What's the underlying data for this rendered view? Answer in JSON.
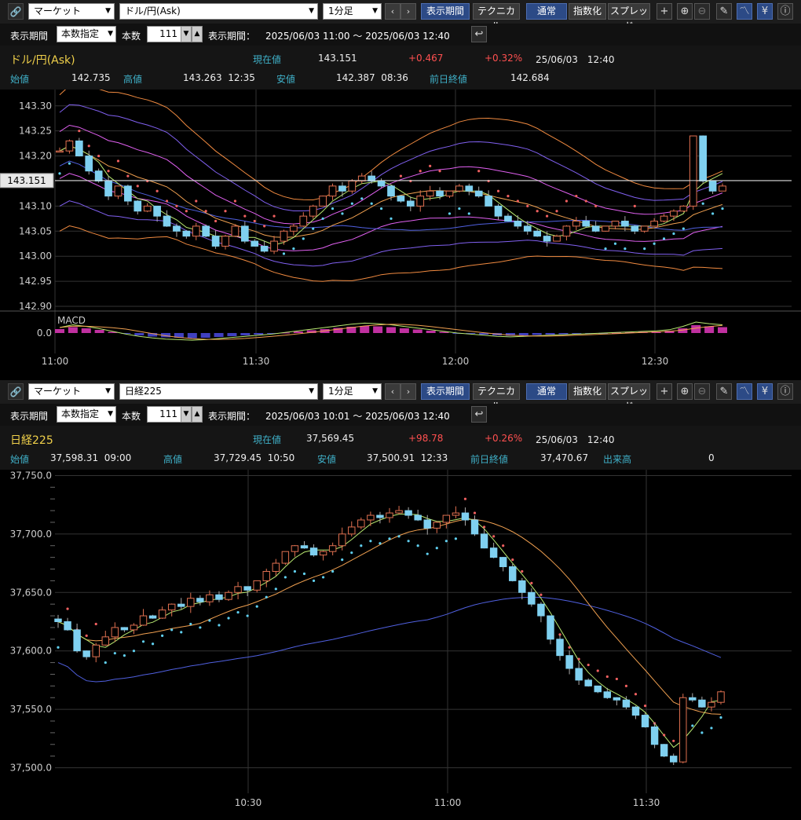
{
  "top": {
    "market_select": "マーケット",
    "symbol_select": "ドル/円(Ask)",
    "interval_select": "1分足",
    "display_period_btn": "表示期間",
    "technical_btn": "テクニカル",
    "normal_btn": "通常",
    "index_btn": "指数化",
    "spread_btn": "スプレッド",
    "period_label": "表示期間",
    "period_mode": "本数指定",
    "count_label": "本数",
    "count_value": "111",
    "range_label": "表示期間：",
    "range_value": "2025/06/03 11:00 〜 2025/06/03 12:40",
    "symbol_name": "ドル/円(Ask)",
    "current_label": "現在値",
    "current_value": "143.151",
    "change": "+0.467",
    "change_pct": "+0.32%",
    "datetime": "25/06/03　12:40",
    "open_label": "始値",
    "open_value": "142.735",
    "high_label": "高値",
    "high_value": "143.263  12:35",
    "low_label": "安値",
    "low_value": "142.387  08:36",
    "prev_label": "前日終値",
    "prev_value": "142.684",
    "price_tag": "143.151",
    "macd_label": "MACD"
  },
  "bottom": {
    "market_select": "マーケット",
    "symbol_select": "日経225",
    "interval_select": "1分足",
    "display_period_btn": "表示期間",
    "technical_btn": "テクニカル",
    "normal_btn": "通常",
    "index_btn": "指数化",
    "spread_btn": "スプレッド",
    "period_label": "表示期間",
    "period_mode": "本数指定",
    "count_label": "本数",
    "count_value": "111",
    "range_label": "表示期間：",
    "range_value": "2025/06/03 10:01 〜 2025/06/03 12:40",
    "symbol_name": "日経225",
    "current_label": "現在値",
    "current_value": "37,569.45",
    "change": "+98.78",
    "change_pct": "+0.26%",
    "datetime": "25/06/03　12:40",
    "open_label": "始値",
    "open_value": "37,598.31  09:00",
    "high_label": "高値",
    "high_value": "37,729.45  10:50",
    "low_label": "安値",
    "low_value": "37,500.91  12:33",
    "prev_label": "前日終値",
    "prev_value": "37,470.67",
    "volume_label": "出来高",
    "volume_value": "0"
  },
  "colors": {
    "accent_blue": "#2c4a86",
    "up_candle": "#e07050",
    "down_candle": "#7fd0f0",
    "bb_outer": "#f08a40",
    "bb_mid": "#8060f0",
    "bb_inner": "#e060f0",
    "ma_short": "#b8e870",
    "ma_mid": "#f0a050",
    "ma_long": "#5060e0",
    "sar_up": "#60d0f0",
    "sar_down": "#f06060",
    "price_line": "#ddd",
    "macd_hist": "#c030a0",
    "text_symbol": "#f0d04a",
    "text_label": "#3fb0c8",
    "text_up": "#ff5050"
  },
  "chart_data": [
    {
      "type": "candlestick",
      "title": "ドル/円(Ask)",
      "x_ticks": [
        "11:00",
        "11:30",
        "12:00",
        "12:30"
      ],
      "y_ticks": [
        "143.30",
        "143.25",
        "143.20",
        "143.15",
        "143.10",
        "143.05",
        "143.00",
        "142.95",
        "142.90"
      ],
      "ylim": [
        142.9,
        143.32
      ],
      "grid": true,
      "close": [
        143.21,
        143.23,
        143.2,
        143.17,
        143.15,
        143.12,
        143.14,
        143.11,
        143.09,
        143.1,
        143.08,
        143.06,
        143.05,
        143.04,
        143.06,
        143.04,
        143.02,
        143.04,
        143.06,
        143.03,
        143.02,
        143.01,
        143.03,
        143.05,
        143.06,
        143.08,
        143.1,
        143.12,
        143.14,
        143.13,
        143.15,
        143.16,
        143.15,
        143.14,
        143.12,
        143.11,
        143.1,
        143.12,
        143.13,
        143.12,
        143.13,
        143.14,
        143.13,
        143.12,
        143.1,
        143.08,
        143.07,
        143.06,
        143.05,
        143.04,
        143.03,
        143.04,
        143.06,
        143.07,
        143.06,
        143.05,
        143.06,
        143.07,
        143.06,
        143.05,
        143.06,
        143.07,
        143.08,
        143.09,
        143.1,
        143.24,
        143.15,
        143.13,
        143.14
      ],
      "series": [
        {
          "name": "MACD",
          "values": [
            0.01,
            0.015,
            0.012,
            0.008,
            0.003,
            -0.002,
            -0.006,
            -0.009,
            -0.011,
            -0.012,
            -0.013,
            -0.012,
            -0.01,
            -0.008,
            -0.006,
            -0.004,
            -0.002,
            0.001,
            0.004,
            0.007,
            0.01,
            0.013,
            0.016,
            0.018,
            0.017,
            0.015,
            0.012,
            0.009,
            0.006,
            0.003,
            0.0,
            -0.002,
            -0.004,
            -0.006,
            -0.007,
            -0.006,
            -0.005,
            -0.004,
            -0.003,
            -0.002,
            -0.001,
            0.0,
            0.001,
            0.002,
            0.003,
            0.004,
            0.006,
            0.012,
            0.02,
            0.017,
            0.015
          ]
        }
      ]
    },
    {
      "type": "candlestick",
      "title": "日経225",
      "x_ticks": [
        "10:30",
        "11:00",
        "11:30"
      ],
      "y_ticks": [
        "37,750.0",
        "37,700.0",
        "37,650.0",
        "37,600.0",
        "37,550.0",
        "37,500.0"
      ],
      "ylim": [
        37497,
        37755
      ],
      "grid": true,
      "close": [
        37625,
        37618,
        37600,
        37595,
        37605,
        37612,
        37620,
        37618,
        37622,
        37630,
        37628,
        37635,
        37640,
        37638,
        37645,
        37642,
        37648,
        37644,
        37650,
        37655,
        37652,
        37660,
        37668,
        37675,
        37685,
        37690,
        37688,
        37682,
        37685,
        37690,
        37700,
        37706,
        37712,
        37716,
        37714,
        37718,
        37720,
        37716,
        37712,
        37705,
        37710,
        37716,
        37718,
        37712,
        37700,
        37688,
        37680,
        37672,
        37660,
        37650,
        37640,
        37630,
        37610,
        37596,
        37585,
        37575,
        37570,
        37565,
        37560,
        37558,
        37552,
        37545,
        37535,
        37520,
        37510,
        37505,
        37560,
        37558,
        37552,
        37556,
        37565
      ]
    }
  ]
}
